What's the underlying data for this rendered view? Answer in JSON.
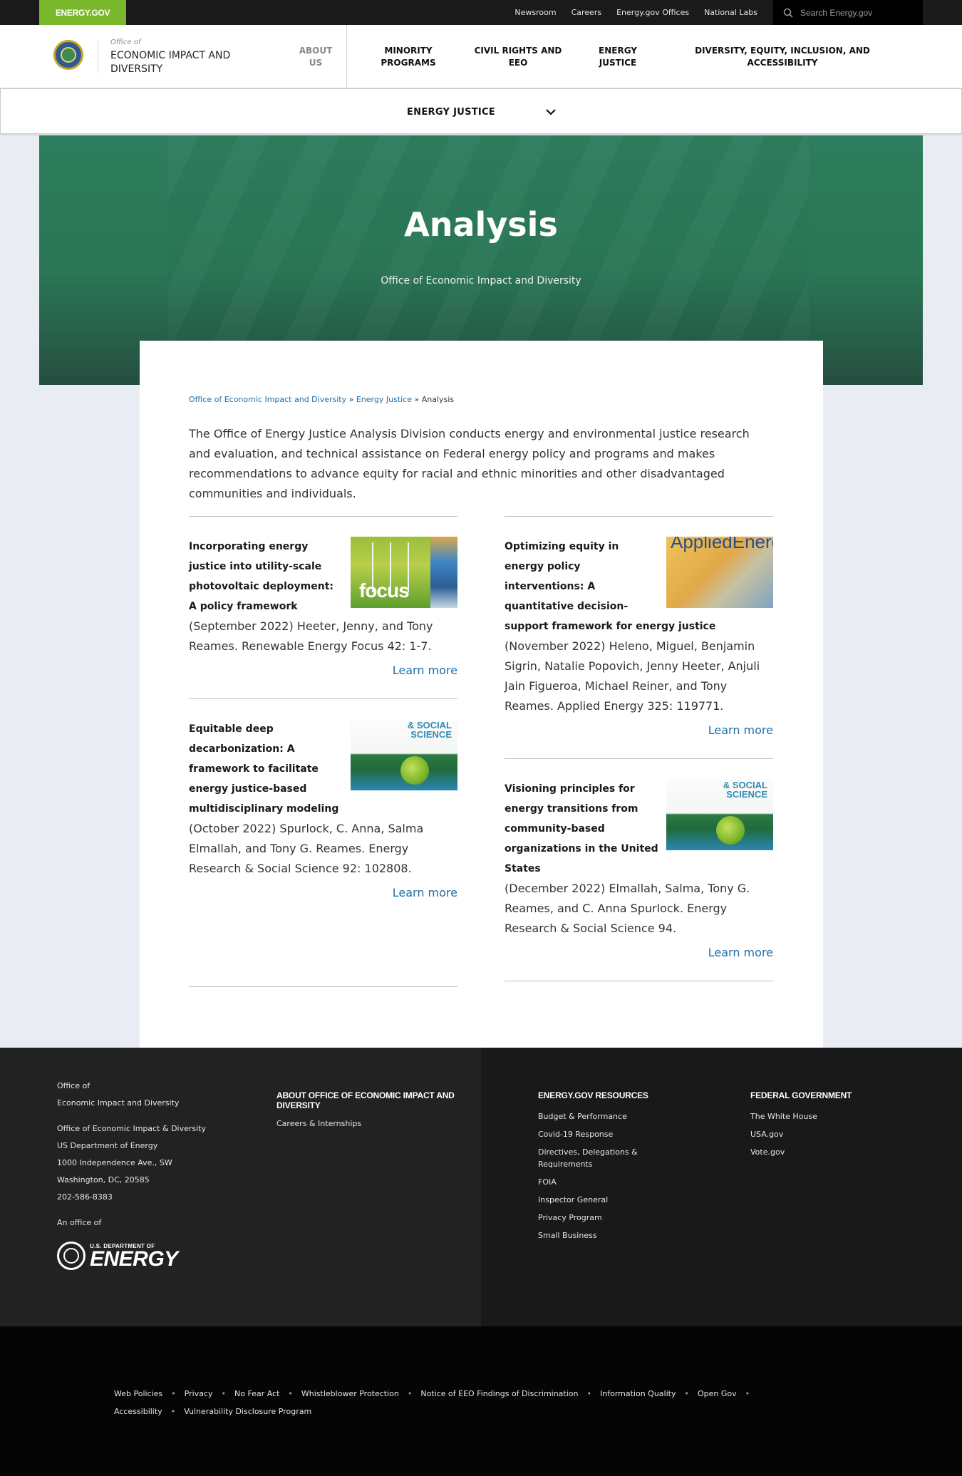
{
  "topbar": {
    "brand": "ENERGY.GOV",
    "links": [
      "Newsroom",
      "Careers",
      "Energy.gov Offices",
      "National Labs"
    ],
    "search_placeholder": "Search Energy.gov"
  },
  "header": {
    "office_of": "Office of",
    "office_name": "Economic Impact and Diversity",
    "about": "About Us",
    "nav": [
      "Minority Programs",
      "Civil Rights and EEO",
      "Energy Justice",
      "Diversity, Equity, Inclusion, and Accessibility"
    ]
  },
  "section_nav": {
    "current": "ENERGY JUSTICE"
  },
  "hero": {
    "title": "Analysis",
    "subtitle": "Office of Economic Impact and Diversity"
  },
  "breadcrumb": {
    "items": [
      "Office of Economic Impact and Diversity",
      "Energy Justice"
    ],
    "separator": "»",
    "current": "Analysis"
  },
  "intro": "The Office of Energy Justice Analysis Division conducts energy and environmental justice research and evaluation, and technical assistance on Federal energy policy and programs and makes recommendations to advance equity for racial and ethnic minorities and other disadvantaged communities and individuals.",
  "learn_more": "Learn more",
  "publications": [
    {
      "title": "Incorporating energy justice into utility-scale photovoltaic deployment: A policy framework",
      "citation": "(September 2022) Heeter, Jenny, and Tony Reames. Renewable Energy Focus 42: 1-7.",
      "thumb_text": "focus"
    },
    {
      "title": "Optimizing equity in energy policy interventions: A quantitative decision-support framework for energy justice",
      "citation": "(November 2022) Heleno, Miguel, Benjamin Sigrin, Natalie Popovich, Jenny Heeter, Anjuli Jain Figueroa, Michael Reiner, and Tony Reames. Applied Energy 325: 119771.",
      "thumb_text": "AppliedEnergy"
    },
    {
      "title": "Equitable deep decarbonization: A framework to facilitate energy justice-based multidisciplinary modeling",
      "citation": "(October 2022) Spurlock, C. Anna, Salma Elmallah, and Tony G. Reames. Energy Research & Social Science 92: 102808.",
      "thumb_text": "& SOCIAL SCIENCE"
    },
    {
      "title": "Visioning principles for energy transitions from community-based organizations in the United States",
      "citation": "(December 2022) Elmallah, Salma, Tony G. Reames, and C. Anna Spurlock. Energy Research & Social Science 94.",
      "thumb_text": "& SOCIAL SCIENCE"
    }
  ],
  "footer": {
    "office_lines": [
      "Office of",
      "Economic Impact and Diversity"
    ],
    "address_lines": [
      "Office of Economic Impact & Diversity",
      "US Department of Energy",
      "1000 Independence Ave., SW",
      "Washington, DC, 20585",
      "202-586-8383"
    ],
    "an_office_of": "An office of",
    "doe_small": "U.S. DEPARTMENT OF",
    "doe_big": "ENERGY",
    "about_head": "ABOUT OFFICE OF ECONOMIC IMPACT AND DIVERSITY",
    "about_links": [
      "Careers & Internships"
    ],
    "resources_head": "ENERGY.GOV RESOURCES",
    "resources_links": [
      "Budget & Performance",
      "Covid-19 Response",
      "Directives, Delegations & Requirements",
      "FOIA",
      "Inspector General",
      "Privacy Program",
      "Small Business"
    ],
    "federal_head": "FEDERAL GOVERNMENT",
    "federal_links": [
      "The White House",
      "USA.gov",
      "Vote.gov"
    ]
  },
  "legal_links": [
    "Web Policies",
    "Privacy",
    "No Fear Act",
    "Whistleblower Protection",
    "Notice of EEO Findings of Discrimination",
    "Information Quality",
    "Open Gov",
    "Accessibility",
    "Vulnerability Disclosure Program"
  ],
  "colors": {
    "brand_green": "#79b82a",
    "hero_green": "#2d7e5e",
    "link_blue": "#1f6fa8",
    "footer_dark": "#222222"
  }
}
